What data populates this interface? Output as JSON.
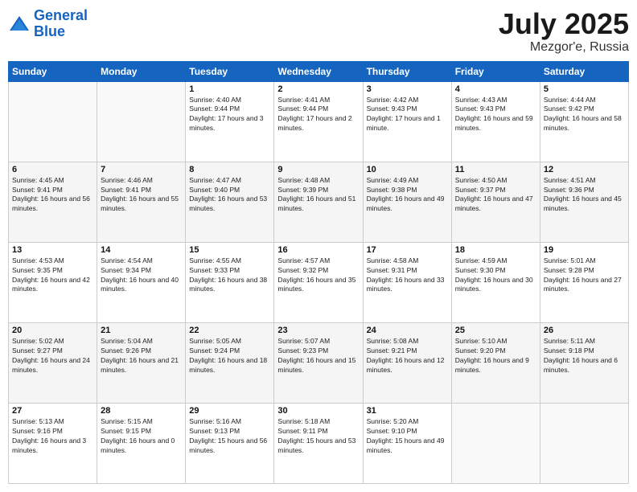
{
  "logo": {
    "line1": "General",
    "line2": "Blue"
  },
  "title": "July 2025",
  "subtitle": "Mezgor'e, Russia",
  "header_days": [
    "Sunday",
    "Monday",
    "Tuesday",
    "Wednesday",
    "Thursday",
    "Friday",
    "Saturday"
  ],
  "weeks": [
    [
      {
        "day": "",
        "sunrise": "",
        "sunset": "",
        "daylight": ""
      },
      {
        "day": "",
        "sunrise": "",
        "sunset": "",
        "daylight": ""
      },
      {
        "day": "1",
        "sunrise": "Sunrise: 4:40 AM",
        "sunset": "Sunset: 9:44 PM",
        "daylight": "Daylight: 17 hours and 3 minutes."
      },
      {
        "day": "2",
        "sunrise": "Sunrise: 4:41 AM",
        "sunset": "Sunset: 9:44 PM",
        "daylight": "Daylight: 17 hours and 2 minutes."
      },
      {
        "day": "3",
        "sunrise": "Sunrise: 4:42 AM",
        "sunset": "Sunset: 9:43 PM",
        "daylight": "Daylight: 17 hours and 1 minute."
      },
      {
        "day": "4",
        "sunrise": "Sunrise: 4:43 AM",
        "sunset": "Sunset: 9:43 PM",
        "daylight": "Daylight: 16 hours and 59 minutes."
      },
      {
        "day": "5",
        "sunrise": "Sunrise: 4:44 AM",
        "sunset": "Sunset: 9:42 PM",
        "daylight": "Daylight: 16 hours and 58 minutes."
      }
    ],
    [
      {
        "day": "6",
        "sunrise": "Sunrise: 4:45 AM",
        "sunset": "Sunset: 9:41 PM",
        "daylight": "Daylight: 16 hours and 56 minutes."
      },
      {
        "day": "7",
        "sunrise": "Sunrise: 4:46 AM",
        "sunset": "Sunset: 9:41 PM",
        "daylight": "Daylight: 16 hours and 55 minutes."
      },
      {
        "day": "8",
        "sunrise": "Sunrise: 4:47 AM",
        "sunset": "Sunset: 9:40 PM",
        "daylight": "Daylight: 16 hours and 53 minutes."
      },
      {
        "day": "9",
        "sunrise": "Sunrise: 4:48 AM",
        "sunset": "Sunset: 9:39 PM",
        "daylight": "Daylight: 16 hours and 51 minutes."
      },
      {
        "day": "10",
        "sunrise": "Sunrise: 4:49 AM",
        "sunset": "Sunset: 9:38 PM",
        "daylight": "Daylight: 16 hours and 49 minutes."
      },
      {
        "day": "11",
        "sunrise": "Sunrise: 4:50 AM",
        "sunset": "Sunset: 9:37 PM",
        "daylight": "Daylight: 16 hours and 47 minutes."
      },
      {
        "day": "12",
        "sunrise": "Sunrise: 4:51 AM",
        "sunset": "Sunset: 9:36 PM",
        "daylight": "Daylight: 16 hours and 45 minutes."
      }
    ],
    [
      {
        "day": "13",
        "sunrise": "Sunrise: 4:53 AM",
        "sunset": "Sunset: 9:35 PM",
        "daylight": "Daylight: 16 hours and 42 minutes."
      },
      {
        "day": "14",
        "sunrise": "Sunrise: 4:54 AM",
        "sunset": "Sunset: 9:34 PM",
        "daylight": "Daylight: 16 hours and 40 minutes."
      },
      {
        "day": "15",
        "sunrise": "Sunrise: 4:55 AM",
        "sunset": "Sunset: 9:33 PM",
        "daylight": "Daylight: 16 hours and 38 minutes."
      },
      {
        "day": "16",
        "sunrise": "Sunrise: 4:57 AM",
        "sunset": "Sunset: 9:32 PM",
        "daylight": "Daylight: 16 hours and 35 minutes."
      },
      {
        "day": "17",
        "sunrise": "Sunrise: 4:58 AM",
        "sunset": "Sunset: 9:31 PM",
        "daylight": "Daylight: 16 hours and 33 minutes."
      },
      {
        "day": "18",
        "sunrise": "Sunrise: 4:59 AM",
        "sunset": "Sunset: 9:30 PM",
        "daylight": "Daylight: 16 hours and 30 minutes."
      },
      {
        "day": "19",
        "sunrise": "Sunrise: 5:01 AM",
        "sunset": "Sunset: 9:28 PM",
        "daylight": "Daylight: 16 hours and 27 minutes."
      }
    ],
    [
      {
        "day": "20",
        "sunrise": "Sunrise: 5:02 AM",
        "sunset": "Sunset: 9:27 PM",
        "daylight": "Daylight: 16 hours and 24 minutes."
      },
      {
        "day": "21",
        "sunrise": "Sunrise: 5:04 AM",
        "sunset": "Sunset: 9:26 PM",
        "daylight": "Daylight: 16 hours and 21 minutes."
      },
      {
        "day": "22",
        "sunrise": "Sunrise: 5:05 AM",
        "sunset": "Sunset: 9:24 PM",
        "daylight": "Daylight: 16 hours and 18 minutes."
      },
      {
        "day": "23",
        "sunrise": "Sunrise: 5:07 AM",
        "sunset": "Sunset: 9:23 PM",
        "daylight": "Daylight: 16 hours and 15 minutes."
      },
      {
        "day": "24",
        "sunrise": "Sunrise: 5:08 AM",
        "sunset": "Sunset: 9:21 PM",
        "daylight": "Daylight: 16 hours and 12 minutes."
      },
      {
        "day": "25",
        "sunrise": "Sunrise: 5:10 AM",
        "sunset": "Sunset: 9:20 PM",
        "daylight": "Daylight: 16 hours and 9 minutes."
      },
      {
        "day": "26",
        "sunrise": "Sunrise: 5:11 AM",
        "sunset": "Sunset: 9:18 PM",
        "daylight": "Daylight: 16 hours and 6 minutes."
      }
    ],
    [
      {
        "day": "27",
        "sunrise": "Sunrise: 5:13 AM",
        "sunset": "Sunset: 9:16 PM",
        "daylight": "Daylight: 16 hours and 3 minutes."
      },
      {
        "day": "28",
        "sunrise": "Sunrise: 5:15 AM",
        "sunset": "Sunset: 9:15 PM",
        "daylight": "Daylight: 16 hours and 0 minutes."
      },
      {
        "day": "29",
        "sunrise": "Sunrise: 5:16 AM",
        "sunset": "Sunset: 9:13 PM",
        "daylight": "Daylight: 15 hours and 56 minutes."
      },
      {
        "day": "30",
        "sunrise": "Sunrise: 5:18 AM",
        "sunset": "Sunset: 9:11 PM",
        "daylight": "Daylight: 15 hours and 53 minutes."
      },
      {
        "day": "31",
        "sunrise": "Sunrise: 5:20 AM",
        "sunset": "Sunset: 9:10 PM",
        "daylight": "Daylight: 15 hours and 49 minutes."
      },
      {
        "day": "",
        "sunrise": "",
        "sunset": "",
        "daylight": ""
      },
      {
        "day": "",
        "sunrise": "",
        "sunset": "",
        "daylight": ""
      }
    ]
  ]
}
